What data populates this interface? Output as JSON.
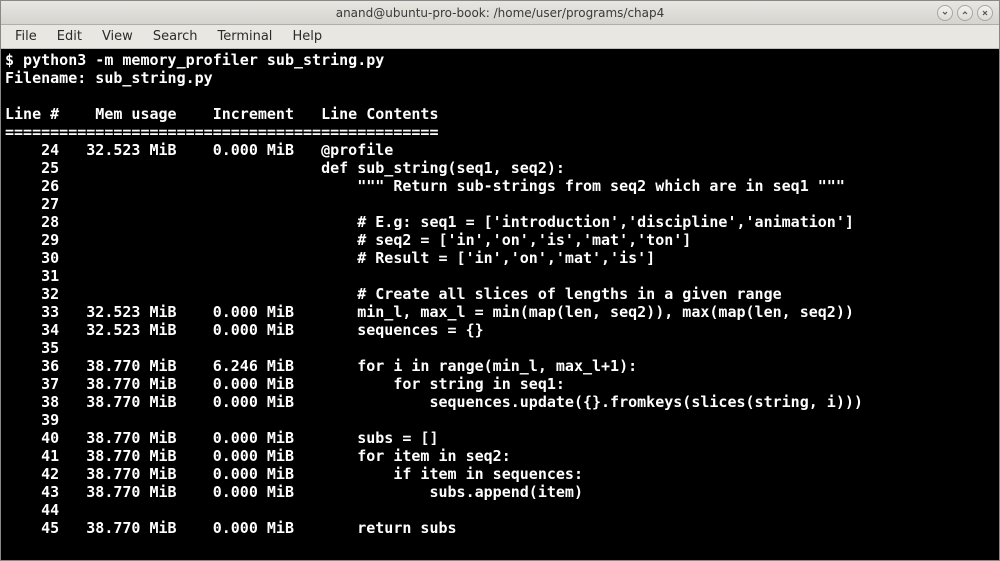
{
  "window": {
    "title": "anand@ubuntu-pro-book: /home/user/programs/chap4"
  },
  "menubar": {
    "items": [
      "File",
      "Edit",
      "View",
      "Search",
      "Terminal",
      "Help"
    ]
  },
  "terminal": {
    "command": "$ python3 -m memory_profiler sub_string.py",
    "filename_line": "Filename: sub_string.py",
    "header": "Line #    Mem usage    Increment   Line Contents",
    "separator": "================================================",
    "rows": [
      {
        "line": "24",
        "mem": "32.523 MiB",
        "inc": "0.000 MiB",
        "code": "@profile"
      },
      {
        "line": "25",
        "mem": "",
        "inc": "",
        "code": "def sub_string(seq1, seq2):"
      },
      {
        "line": "26",
        "mem": "",
        "inc": "",
        "code": "    \"\"\" Return sub-strings from seq2 which are in seq1 \"\"\""
      },
      {
        "line": "27",
        "mem": "",
        "inc": "",
        "code": ""
      },
      {
        "line": "28",
        "mem": "",
        "inc": "",
        "code": "    # E.g: seq1 = ['introduction','discipline','animation']"
      },
      {
        "line": "29",
        "mem": "",
        "inc": "",
        "code": "    # seq2 = ['in','on','is','mat','ton']"
      },
      {
        "line": "30",
        "mem": "",
        "inc": "",
        "code": "    # Result = ['in','on','mat','is']"
      },
      {
        "line": "31",
        "mem": "",
        "inc": "",
        "code": ""
      },
      {
        "line": "32",
        "mem": "",
        "inc": "",
        "code": "    # Create all slices of lengths in a given range"
      },
      {
        "line": "33",
        "mem": "32.523 MiB",
        "inc": "0.000 MiB",
        "code": "    min_l, max_l = min(map(len, seq2)), max(map(len, seq2))"
      },
      {
        "line": "34",
        "mem": "32.523 MiB",
        "inc": "0.000 MiB",
        "code": "    sequences = {}"
      },
      {
        "line": "35",
        "mem": "",
        "inc": "",
        "code": ""
      },
      {
        "line": "36",
        "mem": "38.770 MiB",
        "inc": "6.246 MiB",
        "code": "    for i in range(min_l, max_l+1):"
      },
      {
        "line": "37",
        "mem": "38.770 MiB",
        "inc": "0.000 MiB",
        "code": "        for string in seq1:"
      },
      {
        "line": "38",
        "mem": "38.770 MiB",
        "inc": "0.000 MiB",
        "code": "            sequences.update({}.fromkeys(slices(string, i)))"
      },
      {
        "line": "39",
        "mem": "",
        "inc": "",
        "code": ""
      },
      {
        "line": "40",
        "mem": "38.770 MiB",
        "inc": "0.000 MiB",
        "code": "    subs = []"
      },
      {
        "line": "41",
        "mem": "38.770 MiB",
        "inc": "0.000 MiB",
        "code": "    for item in seq2:"
      },
      {
        "line": "42",
        "mem": "38.770 MiB",
        "inc": "0.000 MiB",
        "code": "        if item in sequences:"
      },
      {
        "line": "43",
        "mem": "38.770 MiB",
        "inc": "0.000 MiB",
        "code": "            subs.append(item)"
      },
      {
        "line": "44",
        "mem": "",
        "inc": "",
        "code": ""
      },
      {
        "line": "45",
        "mem": "38.770 MiB",
        "inc": "0.000 MiB",
        "code": "    return subs"
      }
    ]
  }
}
